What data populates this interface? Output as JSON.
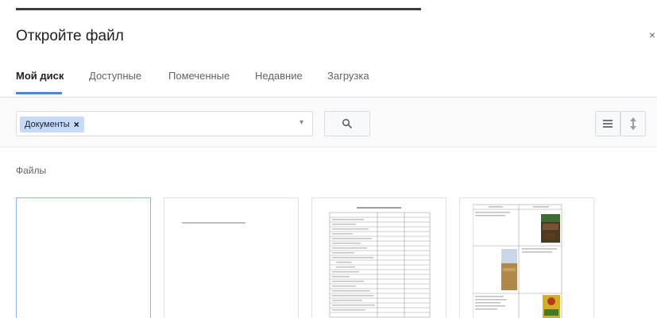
{
  "dialog": {
    "title": "Откройте файл",
    "close_label": "×"
  },
  "tabs": [
    {
      "label": "Мой диск",
      "active": true
    },
    {
      "label": "Доступные",
      "active": false
    },
    {
      "label": "Помеченные",
      "active": false
    },
    {
      "label": "Недавние",
      "active": false
    },
    {
      "label": "Загрузка",
      "active": false
    }
  ],
  "search": {
    "filter_chip": "Документы",
    "chip_remove": "×",
    "dropdown_icon": "caret-down-icon",
    "search_icon": "search-icon"
  },
  "view_controls": {
    "list_icon": "list-view-icon",
    "sort_icon": "sort-icon"
  },
  "files_section": {
    "heading": "Файлы"
  },
  "colors": {
    "accent": "#4285f4",
    "chip_bg": "#c6dafc",
    "border": "#dadce0"
  }
}
